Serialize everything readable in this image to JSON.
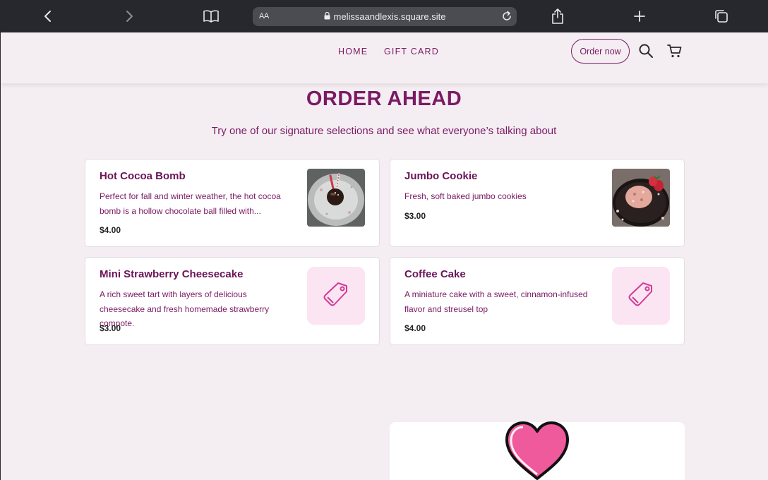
{
  "browser": {
    "url": "melissaandlexis.square.site",
    "reader_label": "AA",
    "icons": [
      "back-icon",
      "forward-icon",
      "book-icon",
      "lock-icon",
      "reload-icon",
      "share-icon",
      "plus-icon",
      "tabs-icon"
    ]
  },
  "header": {
    "nav": [
      {
        "label": "HOME"
      },
      {
        "label": "GIFT CARD"
      }
    ],
    "order_now_label": "Order now",
    "icons": [
      "search-icon",
      "cart-icon"
    ]
  },
  "main": {
    "title": "ORDER AHEAD",
    "subtitle": "Try one of our signature selections and see what everyone’s talking about",
    "items": [
      {
        "name": "Hot Cocoa Bomb",
        "description": "Perfect for fall and winter weather, the hot cocoa bomb is a hollow chocolate ball filled with...",
        "price": "$4.00",
        "image": "photo"
      },
      {
        "name": "Jumbo Cookie",
        "description": "Fresh, soft baked jumbo cookies",
        "price": "$3.00",
        "image": "photo"
      },
      {
        "name": "Mini Strawberry Cheesecake",
        "description": "A rich sweet tart with layers of delicious cheesecake and fresh homemade strawberry compote.",
        "price": "$3.00",
        "image": "tag-icon"
      },
      {
        "name": "Coffee Cake",
        "description": "A miniature cake with a sweet, cinnamon-infused flavor and streusel top",
        "price": "$4.00",
        "image": "tag-icon"
      }
    ]
  },
  "colors": {
    "brand": "#7b1a63",
    "background": "#f4eef3",
    "browser_bar": "#26282d",
    "tag_bg": "#fbe5f3",
    "heart": "#ee5a9b"
  }
}
